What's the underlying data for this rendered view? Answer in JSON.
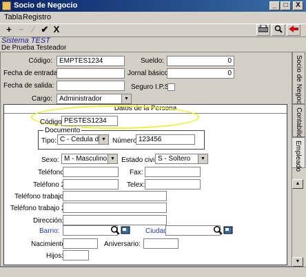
{
  "window": {
    "title": "Socio de Negocio",
    "min": "_",
    "max": "□",
    "close": "X"
  },
  "menu": [
    "Tabla",
    "Registro"
  ],
  "toolbar": {
    "add": "+",
    "close": "X",
    "print": "print-icon",
    "search": "search-icon",
    "exit": "exit-icon"
  },
  "system": {
    "name": "Sistema TEST",
    "user": "De Prueba Testeador"
  },
  "form": {
    "codigo_label": "Código:",
    "codigo": "EMPTES1234",
    "sueldo_label": "Sueldo:",
    "sueldo": "0",
    "fecha_entrada_label": "Fecha de entrada:",
    "fecha_entrada": "",
    "jornal_label": "Jornal básico:",
    "jornal": "0",
    "fecha_salida_label": "Fecha de salida:",
    "fecha_salida": "",
    "seguro_label": "Seguro I.P.S.",
    "cargo_label": "Cargo:",
    "cargo": "Administrador"
  },
  "persona": {
    "title": "Datos de la Persona",
    "codigo_label": "Código:",
    "codigo": "PESTES1234",
    "documento_label": "Documento",
    "tipo_label": "Tipo:",
    "tipo": "C    - Cedula de",
    "numero_label": "Número:",
    "numero": "123456",
    "sexo_label": "Sexo:",
    "sexo": "M    - Masculino",
    "estado_label": "Estado civil:",
    "estado": "S    - Soltero",
    "telefono_label": "Teléfono",
    "fax_label": "Fax:",
    "telefono2_label": "Teléfono 2:",
    "telex_label": "Telex:",
    "trabajo_label": "Teléfono trabajo:",
    "trabajo2_label": "Teléfono trabajo 2:",
    "direccion_label": "Dirección:",
    "barrio_label": "Barrio:",
    "ciudad_label": "Ciudad:",
    "nacimiento_label": "Nacimiento:",
    "aniversario_label": "Aniversario:",
    "hijos_label": "Hijos:"
  },
  "tabs": [
    "Socio de Negocio",
    "Contabilidad",
    "Empleado"
  ],
  "colors": {
    "titlebar": "#0a246a",
    "highlight": "#f2ef2a",
    "link": "#1a3aa8"
  }
}
